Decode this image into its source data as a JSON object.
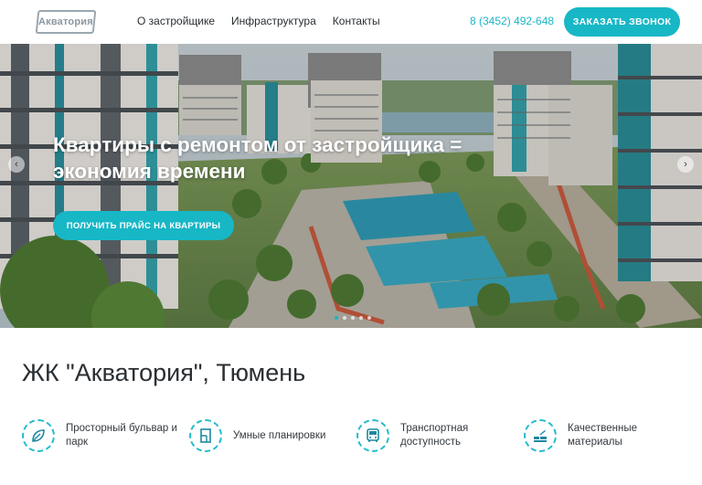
{
  "header": {
    "logo_text": "Акватория",
    "nav": [
      "О застройщике",
      "Инфраструктура",
      "Контакты"
    ],
    "phone": "8 (3452) 492-648",
    "cta_label": "ЗАКАЗАТЬ ЗВОНОК"
  },
  "hero": {
    "title_line1": "Квартиры с ремонтом от застройщика =",
    "title_line2": "экономия времени",
    "button_label": "ПОЛУЧИТЬ ПРАЙС НА КВАРТИРЫ",
    "slides": 5,
    "active_slide": 1
  },
  "main": {
    "title": "ЖК \"Акватория\", Тюмень",
    "features": [
      {
        "icon": "leaf-icon",
        "label": "Просторный бульвар и парк"
      },
      {
        "icon": "floor-plan-icon",
        "label": "Умные планировки"
      },
      {
        "icon": "bus-icon",
        "label": "Транспортная доступность"
      },
      {
        "icon": "bricks-trowel-icon",
        "label": "Качественные материалы"
      }
    ]
  },
  "colors": {
    "accent": "#17b7c6",
    "text": "#2a2f33"
  }
}
